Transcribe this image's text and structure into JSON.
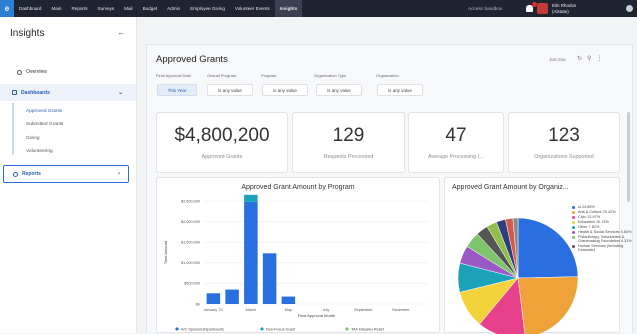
{
  "topnav": {
    "items": [
      "Dashboard",
      "Main",
      "Reports",
      "Surveys",
      "Mail",
      "Budget",
      "Admin",
      "Employee Giving",
      "Volunteer Events",
      "Insights"
    ],
    "active_index": 9,
    "access": "Access Sandbox",
    "user_name": "Elin Rhodus",
    "user_org": "(Alstate)"
  },
  "sidebar": {
    "title": "Insights",
    "overview": "Overview",
    "dashboards": "Dashboards",
    "subitems": [
      "Approved Grants",
      "Submitted Grants",
      "Giving",
      "Volunteering"
    ],
    "reports": "Reports"
  },
  "dashboard": {
    "title": "Approved Grants",
    "just_now": "Just now",
    "filters": [
      {
        "label": "Final Approval Date",
        "value": "This Year"
      },
      {
        "label": "Overall Program",
        "value": "is any value"
      },
      {
        "label": "Program",
        "value": "is any value"
      },
      {
        "label": "Organization Type",
        "value": "is any value"
      },
      {
        "label": "Organization",
        "value": "is any value"
      }
    ],
    "kpis": [
      {
        "value": "$4,800,200",
        "label": "Approved Grants"
      },
      {
        "value": "129",
        "label": "Requests Processed"
      },
      {
        "value": "47",
        "label": "Average Processing (..."
      },
      {
        "value": "123",
        "label": "Organizations Supported"
      }
    ]
  },
  "colors": {
    "accent": "#2d6fd6",
    "topbar": "#1f2430"
  },
  "chart_data": [
    {
      "type": "bar",
      "title": "Approved Grant Amount by Program",
      "xlabel": "Final Approval Month",
      "ylabel": "Total Amount",
      "x_ticks": [
        "January '21",
        "March",
        "May",
        "July",
        "September",
        "November"
      ],
      "y_ticks": [
        "$0",
        "$500,000",
        "$1,000,000",
        "$1,500,000",
        "$2,000,000",
        "$2,500,000"
      ],
      "ylim": [
        0,
        2500000
      ],
      "categories": [
        "Jan",
        "Feb",
        "Mar",
        "Apr",
        "May",
        "Jun",
        "Jul",
        "Aug",
        "Sep",
        "Oct",
        "Nov",
        "Dec"
      ],
      "series": [
        {
          "name": "A/C Sponsorships/Events",
          "color": "#2a6fdf",
          "values": [
            260000,
            350000,
            2480000,
            1230000,
            180000,
            0,
            0,
            0,
            0,
            0,
            0,
            0
          ]
        },
        {
          "name": "Non-Focus Grant",
          "color": "#1aa3b8",
          "values": [
            0,
            0,
            170000,
            0,
            0,
            0,
            0,
            0,
            0,
            0,
            0,
            0
          ]
        },
        {
          "name": "TAF Disaster Relief",
          "color": "#7ec46a",
          "values": [
            0,
            0,
            0,
            0,
            0,
            0,
            0,
            0,
            0,
            0,
            0,
            0
          ]
        }
      ]
    },
    {
      "type": "pie",
      "title": "Approved Grant Amount by Organiz...",
      "slices": [
        {
          "label": "ui 24.65%",
          "value": 24.65,
          "color": "#2a6fdf"
        },
        {
          "label": "Arts & Culture 23.42%",
          "value": 23.42,
          "color": "#f0a23a"
        },
        {
          "label": "Civic 12.97%",
          "value": 12.97,
          "color": "#e8418c"
        },
        {
          "label": "Education 10.13%",
          "value": 10.13,
          "color": "#f4d23c"
        },
        {
          "label": "Other 7.81%",
          "value": 7.81,
          "color": "#1aa3b8"
        },
        {
          "label": "Health & Social Services 4.84%",
          "value": 4.84,
          "color": "#9b59c6"
        },
        {
          "label": "Philanthropy, Voluntarism & Grantmaking Foundation 4.31%",
          "value": 4.31,
          "color": "#7ec46a"
        },
        {
          "label": "Human Services (including Domestic)",
          "value": 3.2,
          "color": "#555555"
        },
        {
          "label": "",
          "value": 2.8,
          "color": "#8fbf4a"
        },
        {
          "label": "",
          "value": 2.5,
          "color": "#2f3e80"
        },
        {
          "label": "",
          "value": 2.0,
          "color": "#d35a4a"
        },
        {
          "label": "",
          "value": 1.36,
          "color": "#888888"
        }
      ]
    }
  ]
}
